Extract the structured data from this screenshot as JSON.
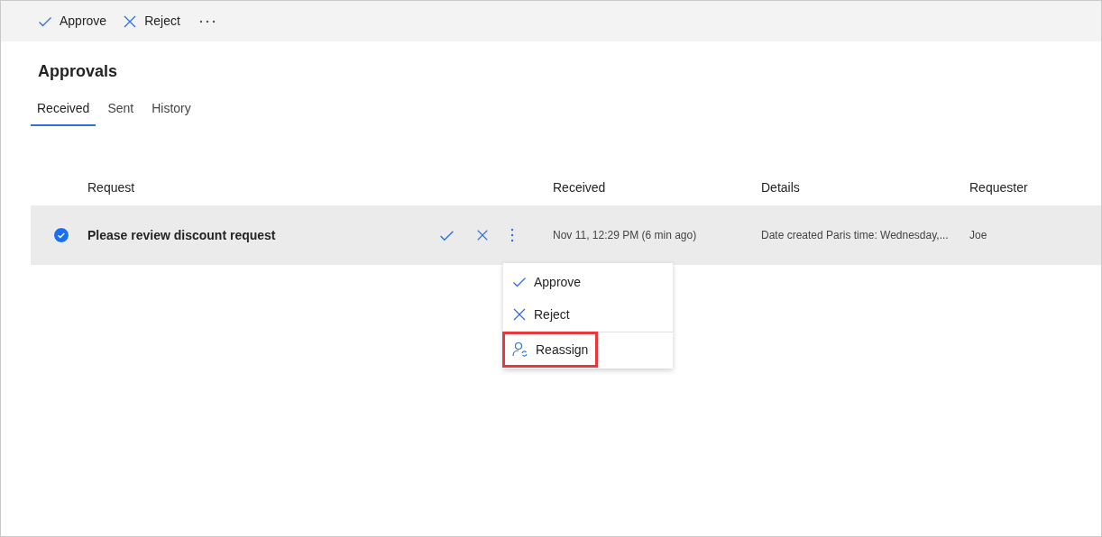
{
  "toolbar": [
    {
      "kind": "approve",
      "label": "Approve"
    },
    {
      "kind": "reject",
      "label": "Reject"
    }
  ],
  "title": "Approvals",
  "tabs": [
    {
      "label": "Received",
      "selected": true
    },
    {
      "label": "Sent",
      "selected": false
    },
    {
      "label": "History",
      "selected": false
    }
  ],
  "table": {
    "columns": [
      "Request",
      "Received",
      "Details",
      "Requester"
    ],
    "rows": [
      {
        "selected": true,
        "request": "Please review discount request",
        "received": "Nov 11, 12:29 PM (6 min ago)",
        "details": "Date created Paris time: Wednesday,...",
        "requester": "Joe"
      }
    ]
  },
  "menu": [
    {
      "kind": "approve",
      "label": "Approve",
      "highlighted": false
    },
    {
      "kind": "reject",
      "label": "Reject",
      "highlighted": false
    },
    {
      "kind": "reassign",
      "label": "Reassign",
      "highlighted": true
    }
  ]
}
